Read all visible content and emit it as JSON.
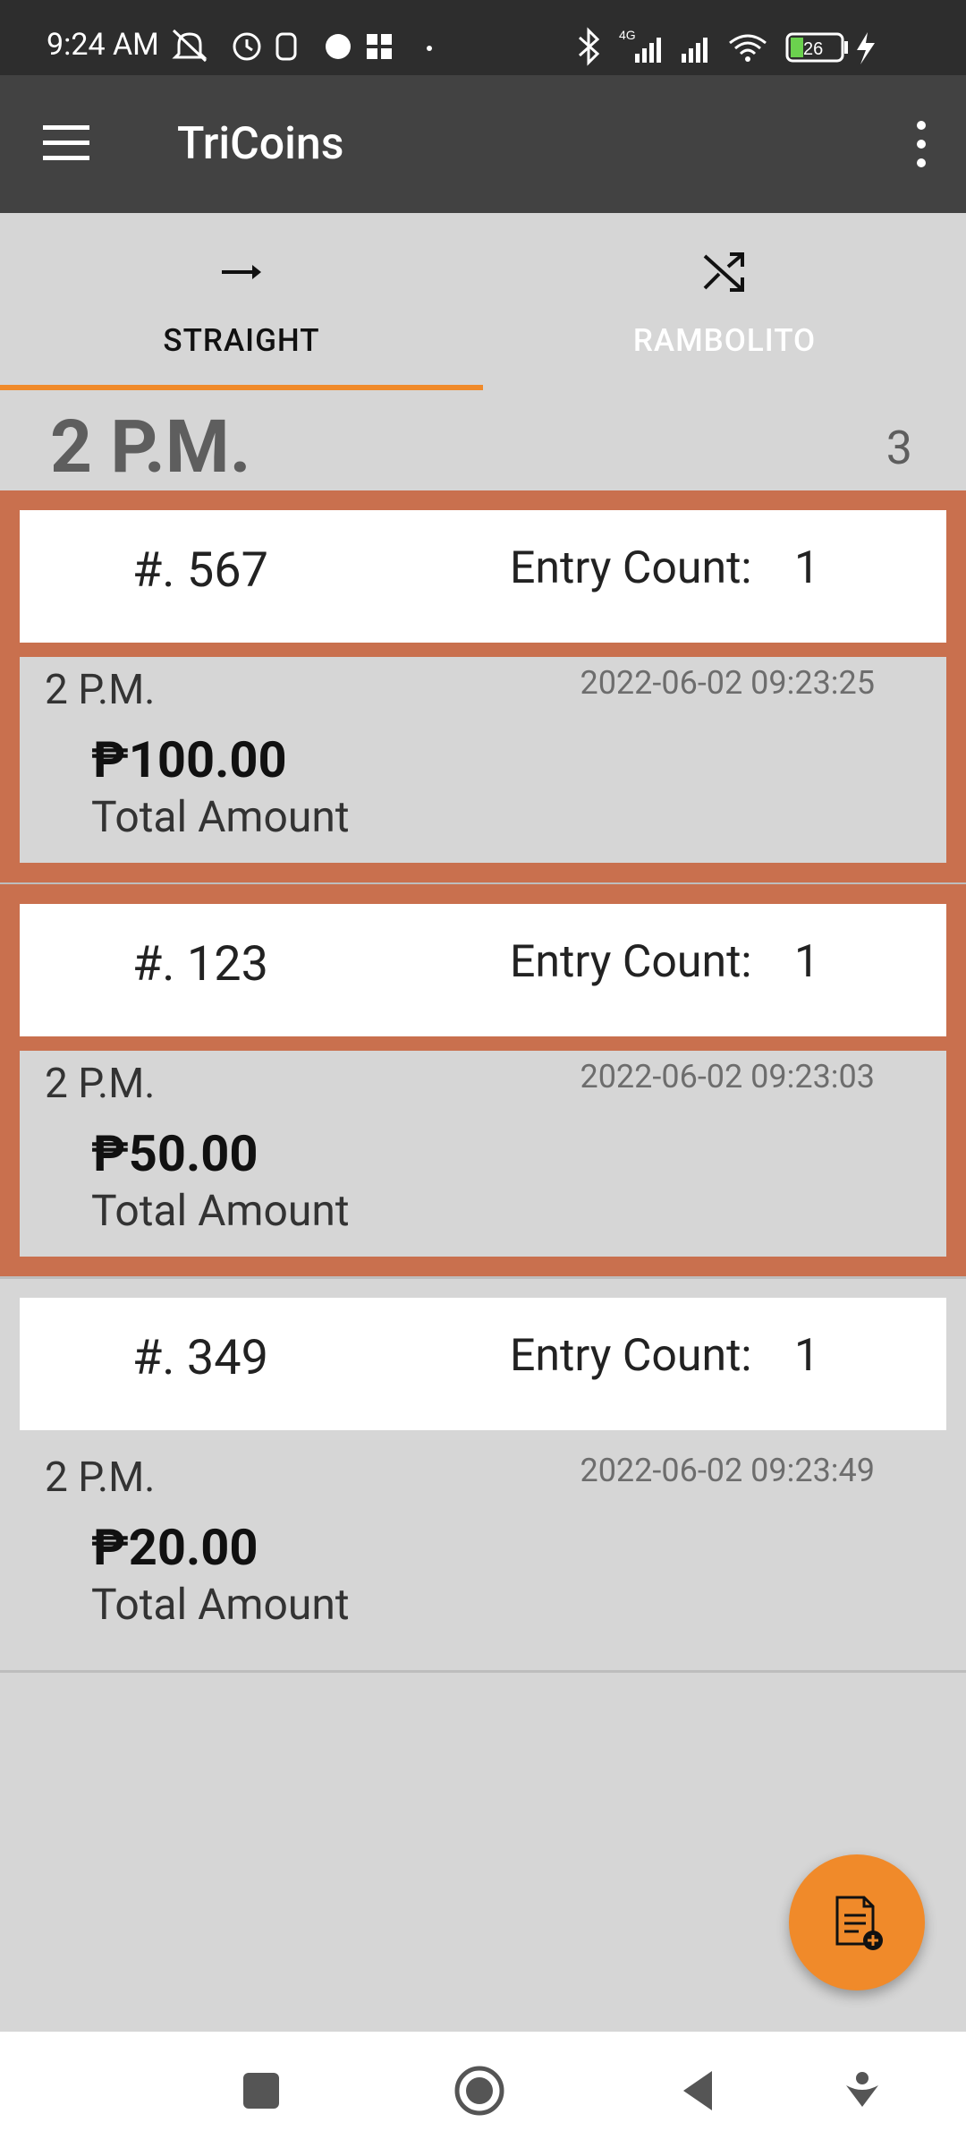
{
  "status_bar": {
    "time": "9:24 AM",
    "battery": "26",
    "network": "4G"
  },
  "app_bar": {
    "title": "TriCoins",
    "menu_icon": "hamburger-menu-icon",
    "overflow_icon": "more-vertical-icon"
  },
  "tabs": [
    {
      "label": "STRAIGHT",
      "icon": "arrow-right-icon",
      "selected": true
    },
    {
      "label": "RAMBOLITO",
      "icon": "shuffle-icon",
      "selected": false
    }
  ],
  "section": {
    "title": "2 P.M.",
    "count": "3"
  },
  "entries": [
    {
      "number": "#. 567",
      "count_label": "Entry Count:",
      "count_value": "1",
      "draw_time": "2 P.M.",
      "timestamp": "2022-06-02 09:23:25",
      "amount": "₱100.00",
      "amount_label": "Total Amount",
      "selected": true
    },
    {
      "number": "#. 123",
      "count_label": "Entry Count:",
      "count_value": "1",
      "draw_time": "2 P.M.",
      "timestamp": "2022-06-02 09:23:03",
      "amount": "₱50.00",
      "amount_label": "Total Amount",
      "selected": true
    },
    {
      "number": "#. 349",
      "count_label": "Entry Count:",
      "count_value": "1",
      "draw_time": "2 P.M.",
      "timestamp": "2022-06-02 09:23:49",
      "amount": "₱20.00",
      "amount_label": "Total Amount",
      "selected": false
    }
  ],
  "colors": {
    "accent": "#f08a2a",
    "selected_border": "#c9704e",
    "app_bar": "#424242",
    "background": "#d6d6d6"
  },
  "fab": {
    "icon": "add-document-icon"
  },
  "nav_bar": {
    "buttons": [
      "recents-square-icon",
      "home-circle-icon",
      "back-triangle-icon",
      "assist-down-icon"
    ]
  }
}
